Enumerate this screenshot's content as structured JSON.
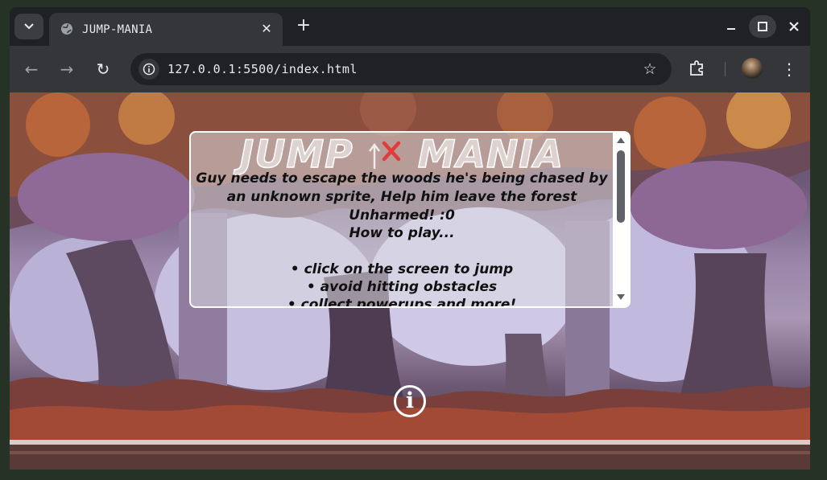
{
  "browser": {
    "tab": {
      "title": "JUMP-MANIA",
      "favicon": "globe-icon",
      "close_glyph": "✕"
    },
    "new_tab_glyph": "+",
    "window_controls": {
      "minimize": "–",
      "maximize": "◻",
      "close": "✕"
    },
    "toolbar": {
      "back_glyph": "←",
      "forward_glyph": "→",
      "reload_glyph": "↻",
      "url": "127.0.0.1:5500/index.html",
      "bookmark_glyph": "☆",
      "menu_glyph": "⋮"
    }
  },
  "game": {
    "title_left": "JUMP",
    "title_right": "MANIA",
    "story": "Guy needs to escape the woods he's being chased by an unknown sprite, Help him leave the forest Unharmed! :0",
    "howto_heading": "How to play...",
    "rules": [
      "• click on the screen to jump",
      "• avoid hitting obstacles",
      "• collect powerups and more!"
    ],
    "info_glyph": "i"
  },
  "colors": {
    "chrome_dark": "#202124",
    "chrome_toolbar": "#35363a",
    "accent_red": "#e23b3b"
  }
}
